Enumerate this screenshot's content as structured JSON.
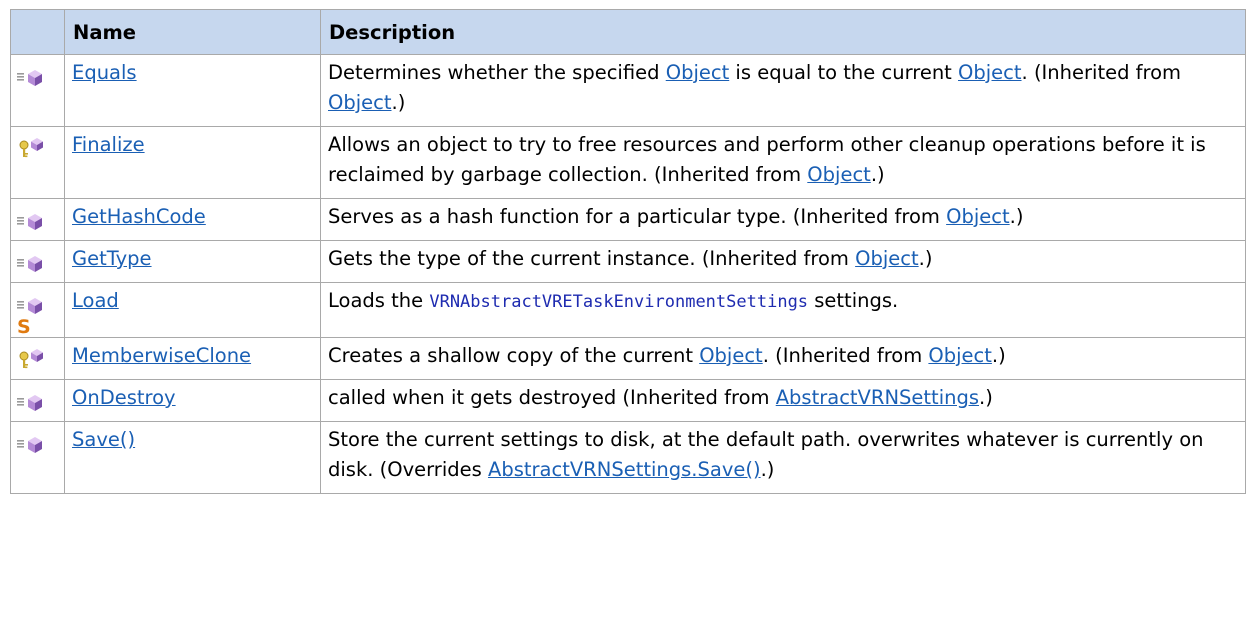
{
  "headers": {
    "icon": "",
    "name": "Name",
    "description": "Description"
  },
  "rows": [
    {
      "icons": [
        "public-method-icon"
      ],
      "name": "Equals",
      "desc": [
        {
          "t": "Determines whether the specified "
        },
        {
          "t": "Object",
          "link": true
        },
        {
          "t": " is equal to the current "
        },
        {
          "t": "Object",
          "link": true
        },
        {
          "t": ". (Inherited from "
        },
        {
          "t": "Object",
          "link": true
        },
        {
          "t": ".)"
        }
      ]
    },
    {
      "icons": [
        "protected-method-icon"
      ],
      "name": "Finalize",
      "desc": [
        {
          "t": "Allows an object to try to free resources and perform other cleanup operations before it is reclaimed by garbage collection. (Inherited from "
        },
        {
          "t": "Object",
          "link": true
        },
        {
          "t": ".)"
        }
      ]
    },
    {
      "icons": [
        "public-method-icon"
      ],
      "name": "GetHashCode",
      "desc": [
        {
          "t": "Serves as a hash function for a particular type. (Inherited from "
        },
        {
          "t": "Object",
          "link": true
        },
        {
          "t": ".)"
        }
      ]
    },
    {
      "icons": [
        "public-method-icon"
      ],
      "name": "GetType",
      "desc": [
        {
          "t": "Gets the type of the current instance. (Inherited from "
        },
        {
          "t": "Object",
          "link": true
        },
        {
          "t": ".)"
        }
      ]
    },
    {
      "icons": [
        "public-method-icon",
        "static-icon"
      ],
      "name": "Load",
      "desc": [
        {
          "t": "Loads the "
        },
        {
          "t": "VRNAbstractVRETaskEnvironmentSettings",
          "code": true
        },
        {
          "t": " settings."
        }
      ]
    },
    {
      "icons": [
        "protected-method-icon"
      ],
      "name": "MemberwiseClone",
      "desc": [
        {
          "t": "Creates a shallow copy of the current "
        },
        {
          "t": "Object",
          "link": true
        },
        {
          "t": ". (Inherited from "
        },
        {
          "t": "Object",
          "link": true
        },
        {
          "t": ".)"
        }
      ]
    },
    {
      "icons": [
        "public-method-icon"
      ],
      "name": "OnDestroy",
      "desc": [
        {
          "t": "called when it gets destroyed (Inherited from "
        },
        {
          "t": "AbstractVRNSettings",
          "link": true
        },
        {
          "t": ".)"
        }
      ]
    },
    {
      "icons": [
        "public-method-icon"
      ],
      "name": "Save()",
      "desc": [
        {
          "t": "Store the current settings to disk, at the default path. overwrites whatever is currently on disk. (Overrides "
        },
        {
          "t": "AbstractVRNSettings.Save()",
          "link": true
        },
        {
          "t": ".)"
        }
      ]
    }
  ],
  "colors": {
    "header_bg": "#c6d7ee",
    "link": "#1a5fb4",
    "border": "#a9a9a9",
    "code": "#1e2bb0"
  }
}
